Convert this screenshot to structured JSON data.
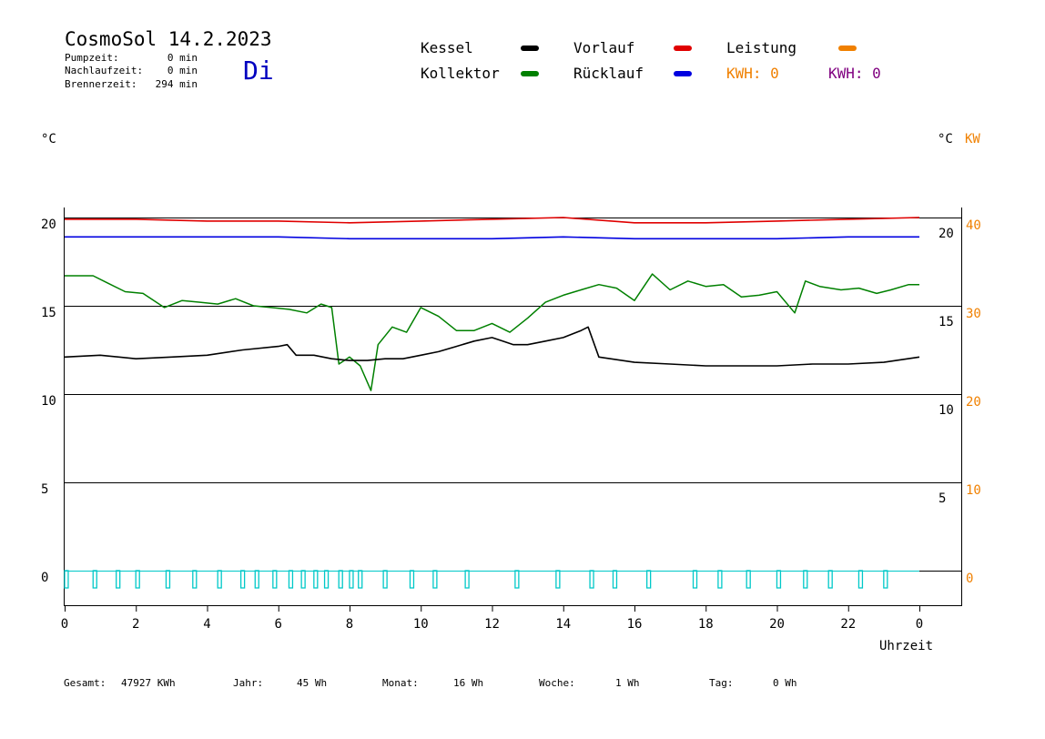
{
  "header": {
    "title": "CosmoSol 14.2.2023",
    "day": "Di",
    "stats": [
      {
        "label": "Pumpzeit:",
        "value": "0 min"
      },
      {
        "label": "Nachlaufzeit:",
        "value": "0 min"
      },
      {
        "label": "Brennerzeit:",
        "value": "294 min"
      }
    ]
  },
  "legend": {
    "items": [
      {
        "label": "Kessel",
        "color": "#000000"
      },
      {
        "label": "Vorlauf",
        "color": "#e00000"
      },
      {
        "label": "Leistung",
        "color": "#f08000"
      },
      {
        "label": "Kollektor",
        "color": "#008000"
      },
      {
        "label": "Rücklauf",
        "color": "#0000e0"
      }
    ],
    "kwh_orange": "KWH: 0",
    "kwh_purple": "KWH: 0"
  },
  "axes": {
    "left_unit": "°C",
    "right_unit": "°C",
    "right_unit2": "KW",
    "xlabel": "Uhrzeit"
  },
  "footer": [
    {
      "label": "Gesamt:",
      "value": "47927 KWh"
    },
    {
      "label": "Jahr:",
      "value": "45 Wh"
    },
    {
      "label": "Monat:",
      "value": "16 Wh"
    },
    {
      "label": "Woche:",
      "value": "1 Wh"
    },
    {
      "label": "Tag:",
      "value": "0 Wh"
    }
  ],
  "chart_data": {
    "type": "line",
    "x_ticks": [
      "0",
      "2",
      "4",
      "6",
      "8",
      "10",
      "12",
      "14",
      "16",
      "18",
      "20",
      "22",
      "0"
    ],
    "xlim": [
      0,
      24
    ],
    "left_ticks": [
      "0",
      "5",
      "10",
      "15",
      "20"
    ],
    "left_ylim": [
      0,
      20
    ],
    "right_ticks": [
      "5",
      "10",
      "15",
      "20"
    ],
    "right_kw_ticks": [
      "0",
      "10",
      "20",
      "30",
      "40"
    ],
    "grid_y": [
      0,
      5,
      10,
      15,
      20
    ],
    "series": [
      {
        "name": "Vorlauf",
        "color": "#e00000",
        "x": [
          0,
          2,
          4,
          6,
          8,
          10,
          12,
          14,
          16,
          18,
          20,
          22,
          24
        ],
        "y": [
          19.9,
          19.9,
          19.8,
          19.8,
          19.7,
          19.8,
          19.9,
          20.0,
          19.7,
          19.7,
          19.8,
          19.9,
          20.0
        ]
      },
      {
        "name": "Rücklauf",
        "color": "#0000e0",
        "x": [
          0,
          2,
          4,
          6,
          8,
          10,
          12,
          14,
          16,
          18,
          20,
          22,
          24
        ],
        "y": [
          18.9,
          18.9,
          18.9,
          18.9,
          18.8,
          18.8,
          18.8,
          18.9,
          18.8,
          18.8,
          18.8,
          18.9,
          18.9
        ]
      },
      {
        "name": "Kollektor",
        "color": "#008000",
        "x": [
          0,
          0.8,
          1.2,
          1.7,
          2.2,
          2.8,
          3.3,
          3.8,
          4.3,
          4.8,
          5.3,
          5.8,
          6.3,
          6.8,
          7.2,
          7.5,
          7.7,
          8.0,
          8.3,
          8.6,
          8.8,
          9.2,
          9.6,
          10.0,
          10.5,
          11.0,
          11.5,
          12.0,
          12.5,
          13.0,
          13.5,
          14.0,
          14.5,
          15.0,
          15.5,
          16.0,
          16.5,
          17.0,
          17.5,
          18.0,
          18.5,
          19.0,
          19.5,
          20.0,
          20.5,
          20.8,
          21.2,
          21.8,
          22.3,
          22.8,
          23.2,
          23.7,
          24.0
        ],
        "y": [
          16.7,
          16.7,
          16.3,
          15.8,
          15.7,
          14.9,
          15.3,
          15.2,
          15.1,
          15.4,
          15.0,
          14.9,
          14.8,
          14.6,
          15.1,
          14.9,
          11.7,
          12.1,
          11.6,
          10.2,
          12.8,
          13.8,
          13.5,
          14.9,
          14.4,
          13.6,
          13.6,
          14.0,
          13.5,
          14.3,
          15.2,
          15.6,
          15.9,
          16.2,
          16.0,
          15.3,
          16.8,
          15.9,
          16.4,
          16.1,
          16.2,
          15.5,
          15.6,
          15.8,
          14.6,
          16.4,
          16.1,
          15.9,
          16.0,
          15.7,
          15.9,
          16.2,
          16.2
        ]
      },
      {
        "name": "Kessel",
        "color": "#000000",
        "x": [
          0,
          1,
          2,
          3,
          4,
          5,
          6,
          6.25,
          6.5,
          7.0,
          7.5,
          8.0,
          8.5,
          9.0,
          9.5,
          10.0,
          10.5,
          11.0,
          11.5,
          12.0,
          12.3,
          12.6,
          13.0,
          13.5,
          14.0,
          14.5,
          14.7,
          15.0,
          16.0,
          17.0,
          18.0,
          19.0,
          20.0,
          21.0,
          22.0,
          23.0,
          24.0
        ],
        "y": [
          12.1,
          12.2,
          12.0,
          12.1,
          12.2,
          12.5,
          12.7,
          12.8,
          12.2,
          12.2,
          12.0,
          11.9,
          11.9,
          12.0,
          12.0,
          12.2,
          12.4,
          12.7,
          13.0,
          13.2,
          13.0,
          12.8,
          12.8,
          13.0,
          13.2,
          13.6,
          13.8,
          12.1,
          11.8,
          11.7,
          11.6,
          11.6,
          11.6,
          11.7,
          11.7,
          11.8,
          12.1
        ]
      }
    ],
    "pump_pulses_hours": [
      0.05,
      0.85,
      1.5,
      2.05,
      2.9,
      3.65,
      4.35,
      5.0,
      5.4,
      5.9,
      6.35,
      6.7,
      7.05,
      7.35,
      7.75,
      8.05,
      8.3,
      9.0,
      9.75,
      10.4,
      11.3,
      12.7,
      13.85,
      14.8,
      15.45,
      16.4,
      17.7,
      18.4,
      19.2,
      20.05,
      20.8,
      21.5,
      22.35,
      23.05
    ],
    "pump_color": "#00c8c8"
  }
}
